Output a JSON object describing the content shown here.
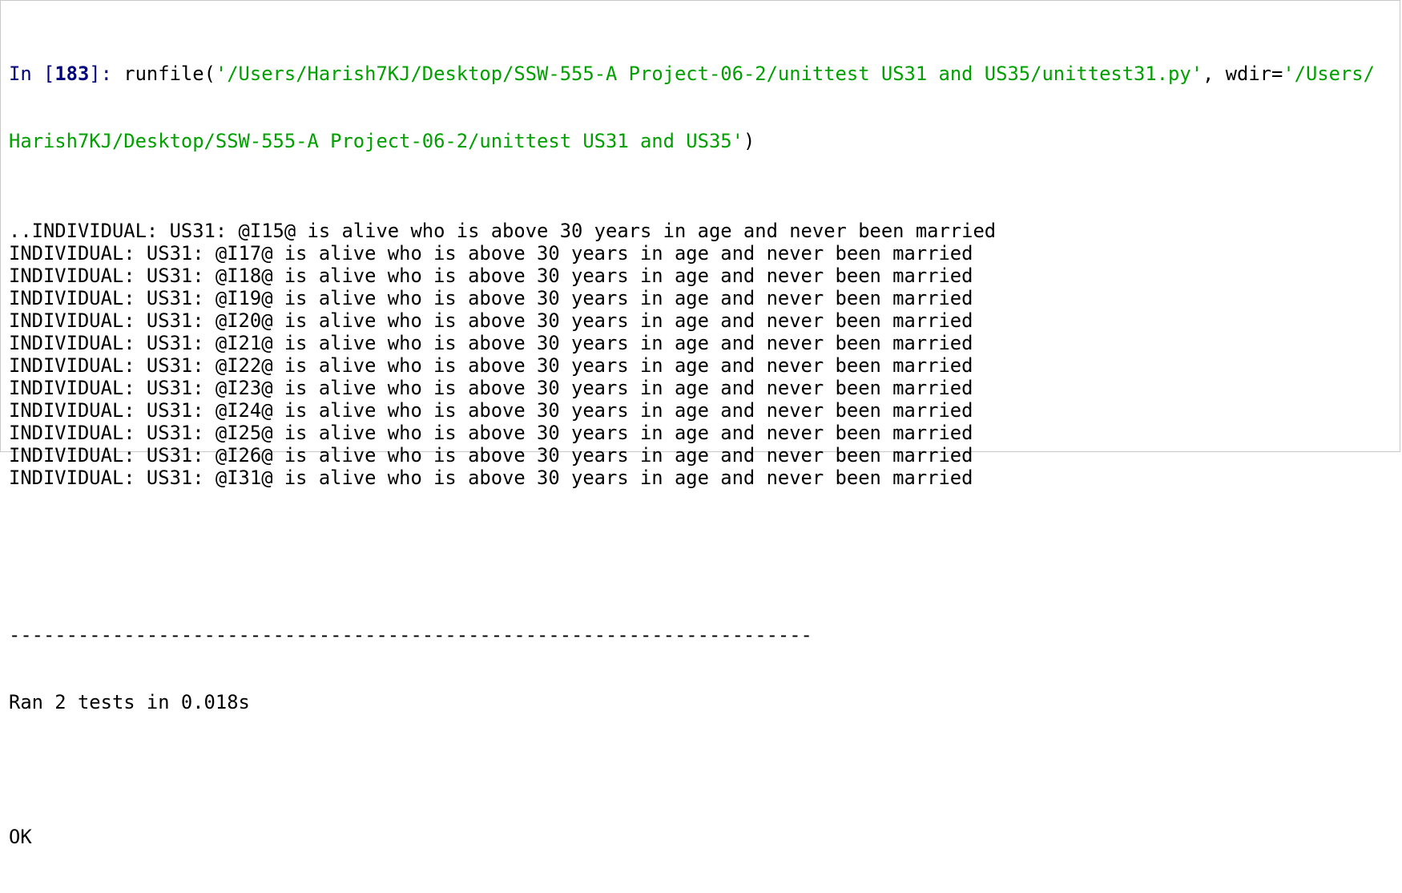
{
  "prompt": {
    "in_label": "In [",
    "number": "183",
    "close": "]: "
  },
  "command": {
    "func": "runfile(",
    "arg_path_line1": "'/Users/Harish7KJ/Desktop/SSW-555-A Project-06-2/unittest US31 and US35/unittest31.py'",
    "sep": ", wdir=",
    "arg_wdir_line1": "'/Users/",
    "arg_wdir_line2": "Harish7KJ/Desktop/SSW-555-A Project-06-2/unittest US31 and US35'",
    "close": ")"
  },
  "output": {
    "lines": [
      "..INDIVIDUAL: US31: @I15@ is alive who is above 30 years in age and never been married",
      "INDIVIDUAL: US31: @I17@ is alive who is above 30 years in age and never been married",
      "INDIVIDUAL: US31: @I18@ is alive who is above 30 years in age and never been married",
      "INDIVIDUAL: US31: @I19@ is alive who is above 30 years in age and never been married",
      "INDIVIDUAL: US31: @I20@ is alive who is above 30 years in age and never been married",
      "INDIVIDUAL: US31: @I21@ is alive who is above 30 years in age and never been married",
      "INDIVIDUAL: US31: @I22@ is alive who is above 30 years in age and never been married",
      "INDIVIDUAL: US31: @I23@ is alive who is above 30 years in age and never been married",
      "INDIVIDUAL: US31: @I24@ is alive who is above 30 years in age and never been married",
      "INDIVIDUAL: US31: @I25@ is alive who is above 30 years in age and never been married",
      "INDIVIDUAL: US31: @I26@ is alive who is above 30 years in age and never been married",
      "INDIVIDUAL: US31: @I31@ is alive who is above 30 years in age and never been married"
    ],
    "separator": "----------------------------------------------------------------------",
    "summary": "Ran 2 tests in 0.018s",
    "result": "OK"
  },
  "colors": {
    "prompt": "#00007f",
    "string": "#00a000",
    "text": "#000000",
    "background": "#ffffff"
  }
}
